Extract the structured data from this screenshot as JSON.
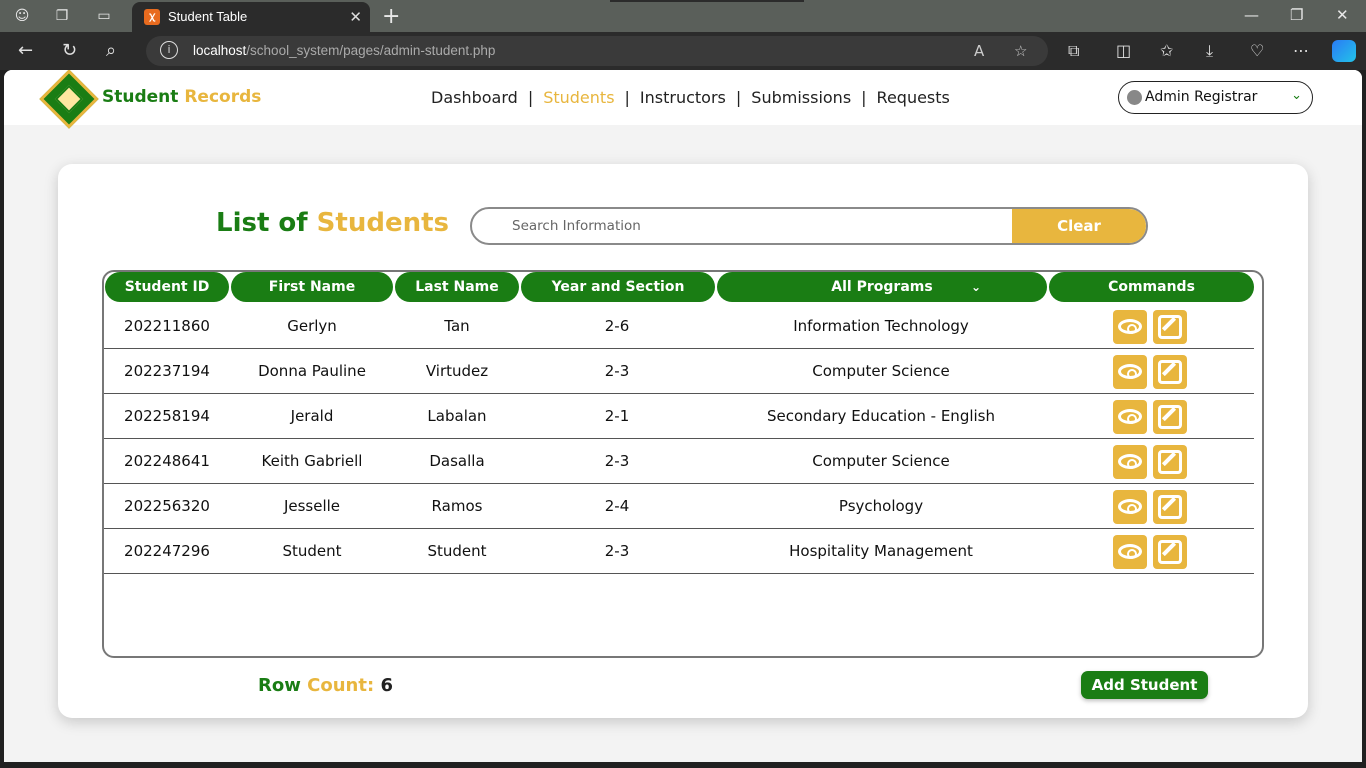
{
  "browser": {
    "tab_title": "Student Table",
    "url_host": "localhost",
    "url_path": "/school_system/pages/admin-student.php"
  },
  "header": {
    "brand_word1": "Student",
    "brand_word2": "Records",
    "nav": [
      "Dashboard",
      "Students",
      "Instructors",
      "Submissions",
      "Requests"
    ],
    "active_nav": "Students",
    "user": "Admin Registrar"
  },
  "main": {
    "title_word1": "List of",
    "title_word2": "Students",
    "search_placeholder": "Search Information",
    "clear_label": "Clear",
    "columns": [
      "Student ID",
      "First Name",
      "Last Name",
      "Year and Section",
      "All Programs",
      "Commands"
    ],
    "rows": [
      {
        "id": "202211860",
        "first": "Gerlyn",
        "last": "Tan",
        "section": "2-6",
        "program": "Information Technology"
      },
      {
        "id": "202237194",
        "first": "Donna Pauline",
        "last": "Virtudez",
        "section": "2-3",
        "program": "Computer Science"
      },
      {
        "id": "202258194",
        "first": "Jerald",
        "last": "Labalan",
        "section": "2-1",
        "program": "Secondary Education - English"
      },
      {
        "id": "202248641",
        "first": "Keith Gabriell",
        "last": "Dasalla",
        "section": "2-3",
        "program": "Computer Science"
      },
      {
        "id": "202256320",
        "first": "Jesselle",
        "last": "Ramos",
        "section": "2-4",
        "program": "Psychology"
      },
      {
        "id": "202247296",
        "first": "Student",
        "last": "Student",
        "section": "2-3",
        "program": "Hospitality Management"
      }
    ],
    "row_count_word1": "Row",
    "row_count_word2": "Count:",
    "row_count_value": "6",
    "add_label": "Add Student"
  },
  "colors": {
    "primary_green": "#1a7d14",
    "accent_gold": "#e8b63e"
  },
  "icons": [
    "view-eye-icon",
    "edit-note-icon"
  ]
}
